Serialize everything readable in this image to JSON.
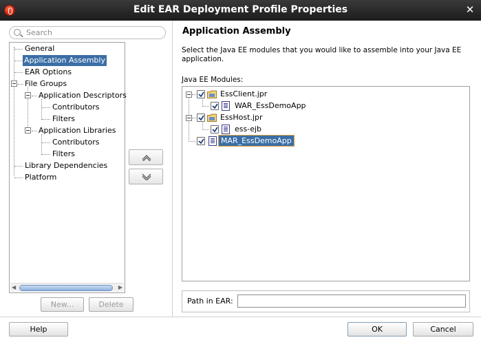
{
  "window": {
    "title": "Edit EAR Deployment Profile Properties"
  },
  "search": {
    "placeholder": "Search"
  },
  "nav": {
    "items": [
      {
        "label": "General"
      },
      {
        "label": "Application Assembly"
      },
      {
        "label": "EAR Options"
      },
      {
        "label": "File Groups"
      },
      {
        "label": "Application Descriptors"
      },
      {
        "label": "Contributors"
      },
      {
        "label": "Filters"
      },
      {
        "label": "Application Libraries"
      },
      {
        "label": "Contributors"
      },
      {
        "label": "Filters"
      },
      {
        "label": "Library Dependencies"
      },
      {
        "label": "Platform"
      }
    ],
    "selected": "Application Assembly"
  },
  "left_buttons": {
    "new_label": "New...",
    "delete_label": "Delete"
  },
  "main": {
    "heading": "Application Assembly",
    "description": "Select the Java EE modules that you would like to assemble into your Java EE application.",
    "modules_label": "Java EE Modules:",
    "modules": [
      {
        "label": "EssClient.jpr",
        "checked": true
      },
      {
        "label": "WAR_EssDemoApp",
        "checked": true
      },
      {
        "label": "EssHost.jpr",
        "checked": true
      },
      {
        "label": "ess-ejb",
        "checked": true
      },
      {
        "label": "MAR_EssDemoApp",
        "checked": true
      }
    ],
    "path_label": "Path in EAR:",
    "path_value": ""
  },
  "footer": {
    "help_label": "Help",
    "ok_label": "OK",
    "cancel_label": "Cancel"
  },
  "icons": [
    "app-icon",
    "close-icon",
    "search-icon",
    "move-up-icon",
    "move-down-icon",
    "folder-icon",
    "document-icon",
    "checkbox-icon"
  ]
}
